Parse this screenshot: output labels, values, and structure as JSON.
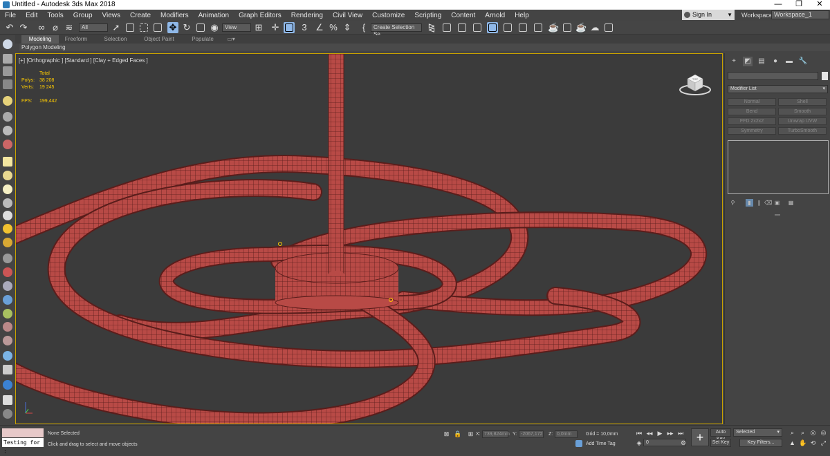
{
  "window": {
    "title": "Untitled - Autodesk 3ds Max 2018",
    "minimize_glyph": "—",
    "maximize_glyph": "❐",
    "close_glyph": "✕"
  },
  "menu": [
    "File",
    "Edit",
    "Tools",
    "Group",
    "Views",
    "Create",
    "Modifiers",
    "Animation",
    "Graph Editors",
    "Rendering",
    "Civil View",
    "Customize",
    "Scripting",
    "Content",
    "Arnold",
    "Help"
  ],
  "account": {
    "sign_in": "Sign In",
    "workspaces_label": "Workspaces:",
    "workspace": "Workspace_1"
  },
  "toolbar": {
    "selection_filter": "All",
    "reference_coord": "View",
    "named_selection": "Create Selection Se",
    "snap_label": "3",
    "percent_glyph": "%"
  },
  "ribbon": {
    "tabs": [
      "Modeling",
      "Freeform",
      "Selection",
      "Object Paint",
      "Populate"
    ],
    "active_tab": 0,
    "panel_label": "Polygon Modeling"
  },
  "viewport": {
    "label": "[+] [Orthographic ] [Standard ] [Clay + Edged Faces ]",
    "stats": {
      "total_label": "Total",
      "polys_label": "Polys:",
      "polys": "38 208",
      "verts_label": "Verts:",
      "verts": "19 245",
      "fps_label": "FPS:",
      "fps": "199,442"
    },
    "viewcube_face": "TOP"
  },
  "command_panel": {
    "modifier_list": "Modifier List",
    "modifiers": [
      "Normal",
      "Shell",
      "Bend",
      "Smooth",
      "FFD 2x2x2",
      "Unwrap UVW",
      "Symmetry",
      "TurboSmooth"
    ]
  },
  "status": {
    "maxscript_text": "Testing for :",
    "selection": "None Selected",
    "prompt": "Click and drag to select and move objects",
    "x_label": "X:",
    "x_value": "739,824mm",
    "y_label": "Y:",
    "y_value": "-2067,172",
    "z_label": "Z:",
    "z_value": "0,0mm",
    "grid": "Grid = 10,0mm",
    "add_time_tag": "Add Time Tag",
    "frame": "0",
    "auto_key": "Auto Key",
    "set_key": "Set Key",
    "key_mode": "Selected",
    "key_filters": "Key Filters..."
  },
  "colors": {
    "accent": "#8fb8e8",
    "viewport_border": "#c8a200",
    "object_red": "#b84a46",
    "stats_yellow": "#ffcc00"
  }
}
